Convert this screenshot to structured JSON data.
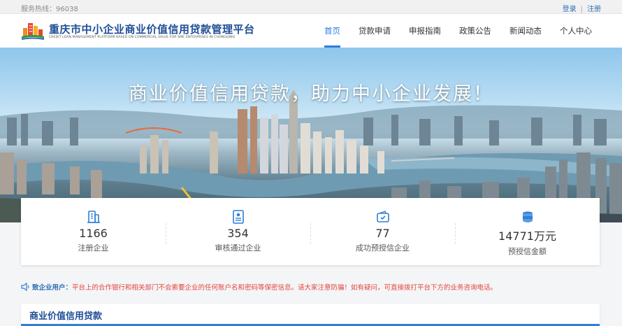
{
  "topbar": {
    "hotline": "服务热线：96038",
    "login": "登录",
    "separator": "|",
    "register": "注册"
  },
  "header": {
    "title": "重庆市中小企业商业价值信用贷款管理平台",
    "subtitle": "CREDIT LOAN MANAGEMENT PLATFORM BASED ON  COMMERCIAL VALUE FOR SME ENTERPRISES IN CHONGQING",
    "logo_icon": "city-building-logo-icon"
  },
  "nav": {
    "items": [
      {
        "label": "首页",
        "active": true
      },
      {
        "label": "贷款申请",
        "active": false
      },
      {
        "label": "申报指南",
        "active": false
      },
      {
        "label": "政策公告",
        "active": false
      },
      {
        "label": "新闻动态",
        "active": false
      },
      {
        "label": "个人中心",
        "active": false
      }
    ]
  },
  "hero": {
    "slogan": "商业价值信用贷款，助力中小企业发展！"
  },
  "stats": [
    {
      "icon": "building-icon",
      "value": "1166",
      "label": "注册企业"
    },
    {
      "icon": "document-check-icon",
      "value": "354",
      "label": "审核通过企业"
    },
    {
      "icon": "wallet-icon",
      "value": "77",
      "label": "成功预授信企业"
    },
    {
      "icon": "coins-icon",
      "value": "14771万元",
      "label": "预授信金额"
    }
  ],
  "notice": {
    "icon": "speaker-icon",
    "label": "致企业用户：",
    "text": "平台上的合作银行和相关部门不会索要企业的任何账户名和密码等保密信息。请大家注意防骗！如有疑问，可直接拨打平台下方的业务咨询电话。"
  },
  "section": {
    "title": "商业价值信用贷款"
  },
  "colors": {
    "primary": "#2f7fd7",
    "brand_dark": "#1e4e96",
    "alert": "#e4453b"
  }
}
